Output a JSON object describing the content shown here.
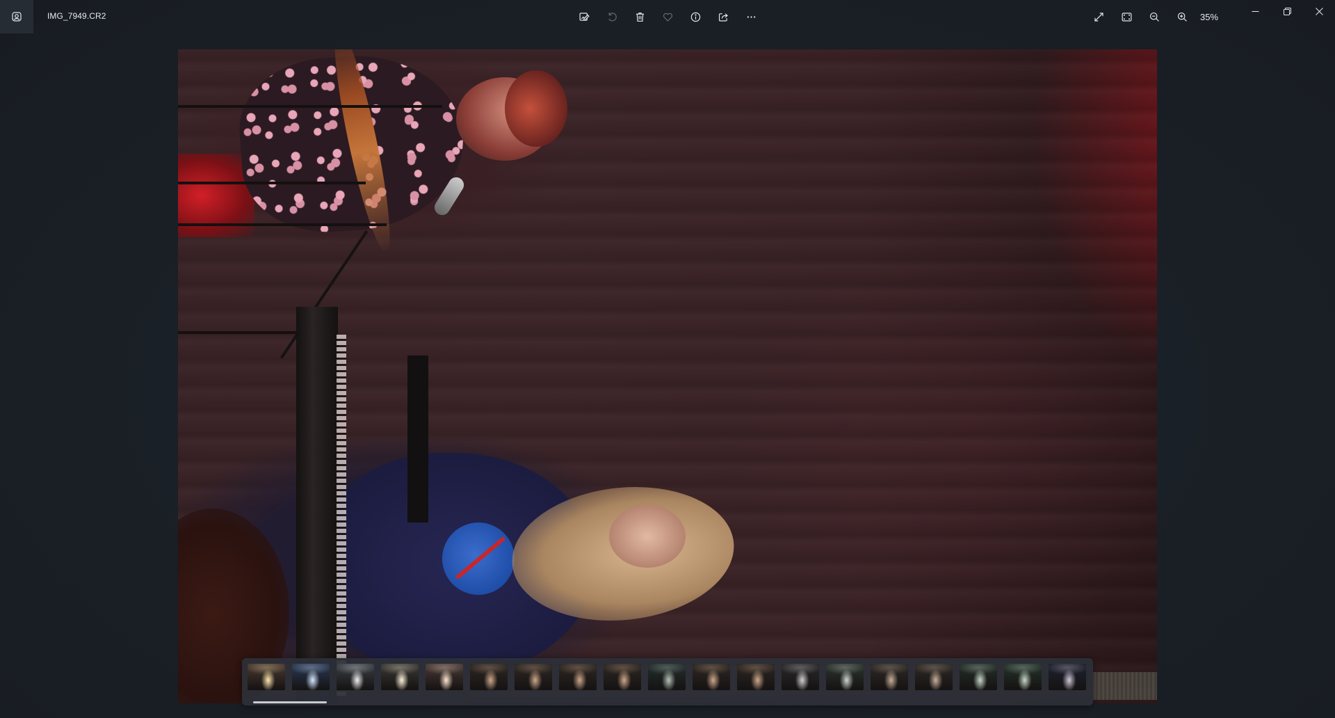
{
  "window": {
    "file_name": "IMG_7949.CR2",
    "zoom_level": "35%"
  },
  "toolbar_center": [
    {
      "name": "edit-image-button",
      "icon": "edit-image-icon",
      "enabled": true
    },
    {
      "name": "rotate-button",
      "icon": "rotate-icon",
      "enabled": false
    },
    {
      "name": "delete-button",
      "icon": "trash-icon",
      "enabled": true
    },
    {
      "name": "favorite-button",
      "icon": "heart-icon",
      "enabled": false
    },
    {
      "name": "file-info-button",
      "icon": "info-icon",
      "enabled": true
    },
    {
      "name": "share-button",
      "icon": "share-icon",
      "enabled": true
    },
    {
      "name": "more-options-button",
      "icon": "ellipsis-icon",
      "enabled": true
    }
  ],
  "toolbar_right": [
    {
      "name": "full-screen-button",
      "icon": "expand-icon"
    },
    {
      "name": "fit-to-window-button",
      "icon": "fit-window-icon"
    },
    {
      "name": "zoom-out-button",
      "icon": "zoom-out-icon"
    },
    {
      "name": "zoom-in-button",
      "icon": "zoom-in-icon"
    }
  ],
  "window_controls": [
    {
      "name": "minimize-button",
      "icon": "minimize-icon"
    },
    {
      "name": "restore-button",
      "icon": "restore-icon"
    },
    {
      "name": "close-button",
      "icon": "close-icon"
    }
  ],
  "filmstrip": {
    "selected_index": 0,
    "thumbnails": [
      {
        "tone": "#4a3a30",
        "light": "#ffe6b0"
      },
      {
        "tone": "#2a3a55",
        "light": "#d6e8ff"
      },
      {
        "tone": "#3a3f45",
        "light": "#f0f0f0"
      },
      {
        "tone": "#3b3a36",
        "light": "#fff2d8"
      },
      {
        "tone": "#4a3a36",
        "light": "#ffe8d0"
      },
      {
        "tone": "#2e2824",
        "light": "#cfa98a"
      },
      {
        "tone": "#2e2824",
        "light": "#cfa98a"
      },
      {
        "tone": "#2e2824",
        "light": "#cfa98a"
      },
      {
        "tone": "#2e2824",
        "light": "#cfa98a"
      },
      {
        "tone": "#23302e",
        "light": "#b6c2b8"
      },
      {
        "tone": "#2e2824",
        "light": "#cfa98a"
      },
      {
        "tone": "#2e2824",
        "light": "#cfa98a"
      },
      {
        "tone": "#2a2a2a",
        "light": "#d0d0d0"
      },
      {
        "tone": "#2b3530",
        "light": "#cfd6cf"
      },
      {
        "tone": "#2e2a26",
        "light": "#c8b09a"
      },
      {
        "tone": "#2e2a26",
        "light": "#c8b09a"
      },
      {
        "tone": "#24302a",
        "light": "#c9d8c9"
      },
      {
        "tone": "#24342a",
        "light": "#c9d8c9"
      },
      {
        "tone": "#1e2230",
        "light": "#d0c8d8"
      }
    ]
  }
}
